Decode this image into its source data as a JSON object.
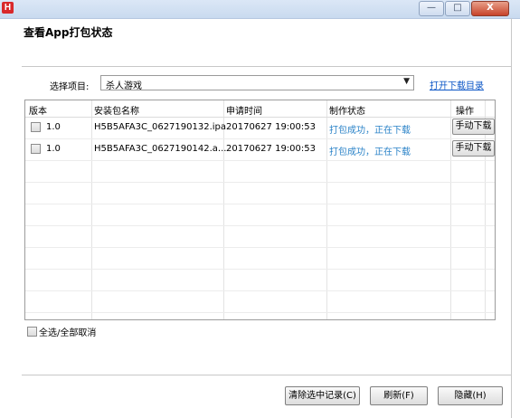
{
  "titlebar": {
    "app_icon_letter": "H",
    "minimize_glyph": "—",
    "maximize_glyph": "□",
    "close_glyph": "X"
  },
  "dialog": {
    "title": "查看App打包状态"
  },
  "project": {
    "label": "选择项目:",
    "selected": "杀人游戏",
    "open_dir_link": "打开下载目录"
  },
  "table": {
    "columns": [
      "版本",
      "安装包名称",
      "申请时间",
      "制作状态",
      "操作"
    ],
    "rows": [
      {
        "version": "1.0",
        "package": "H5B5AFA3C_0627190132.ipa",
        "time": "20170627 19:00:53",
        "status": "打包成功，正在下载",
        "action": "手动下载"
      },
      {
        "version": "1.0",
        "package": "H5B5AFA3C_0627190142.a...",
        "time": "20170627 19:00:53",
        "status": "打包成功，正在下载",
        "action": "手动下载"
      }
    ]
  },
  "select_all": {
    "label": "全选/全部取消"
  },
  "buttons": {
    "clear": "清除选中记录(C)",
    "refresh": "刷新(F)",
    "hide": "隐藏(H)"
  }
}
